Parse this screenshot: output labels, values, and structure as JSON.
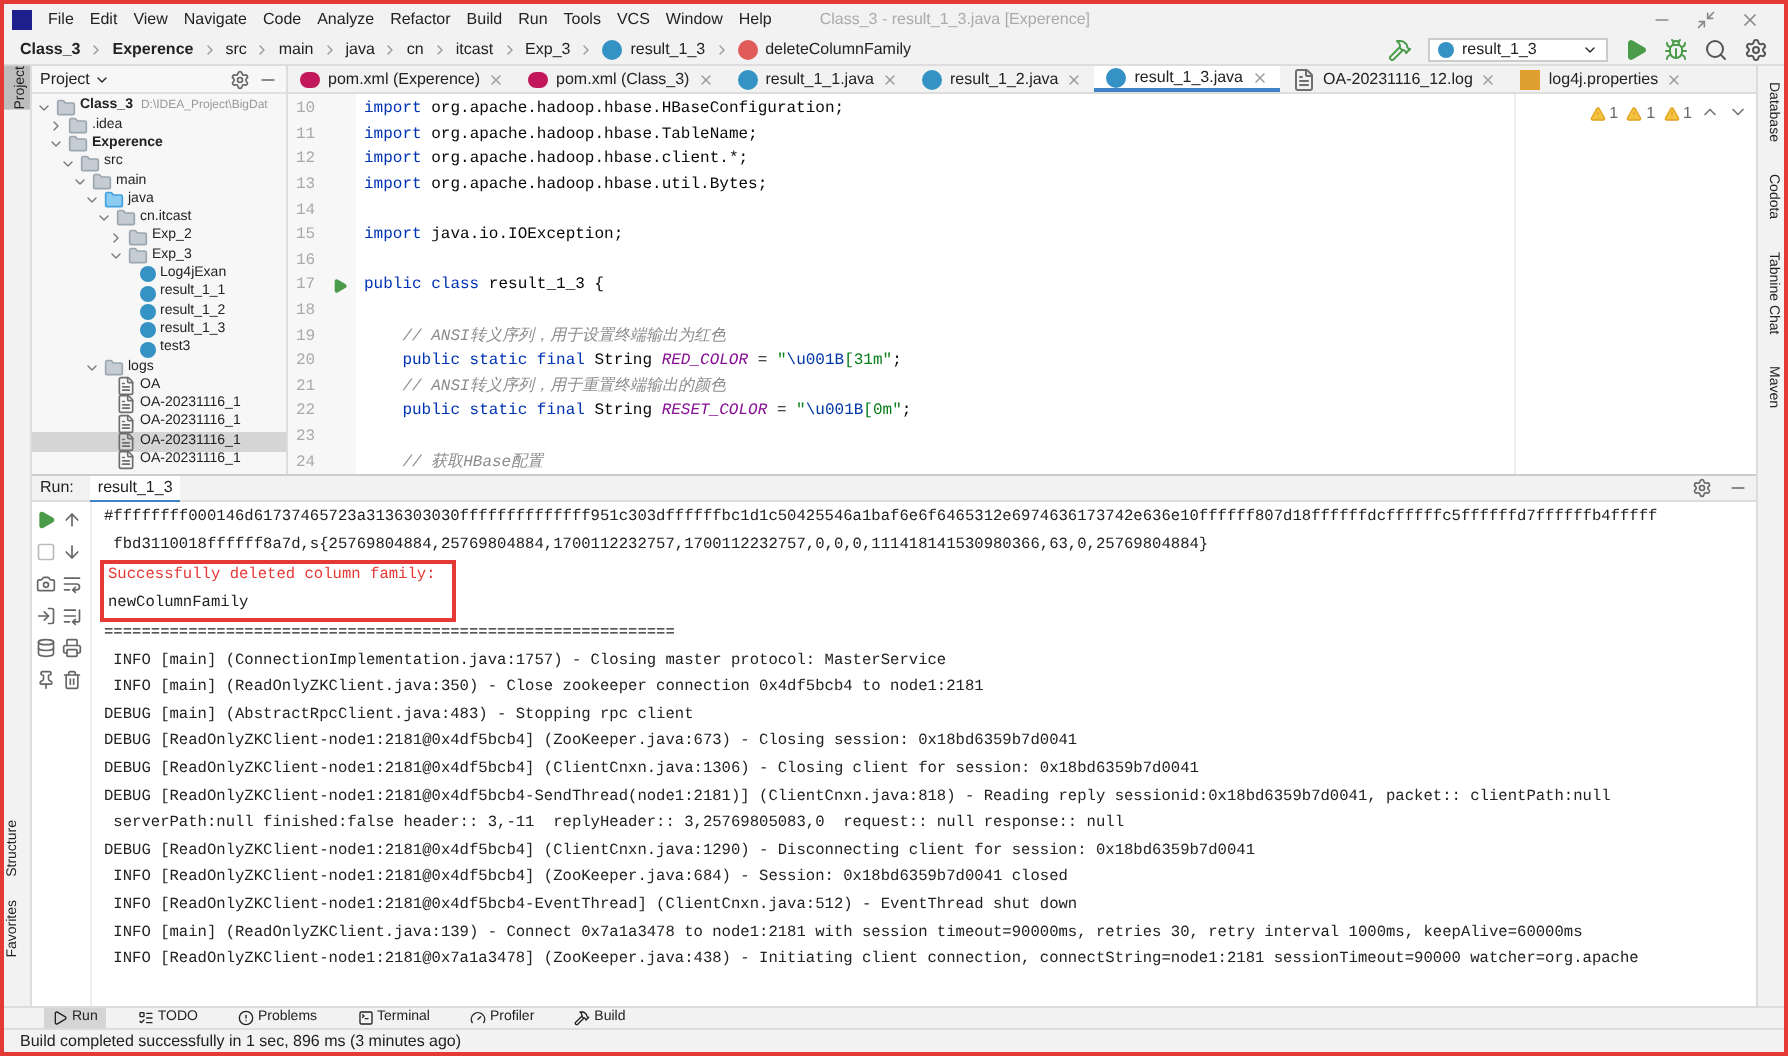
{
  "window": {
    "title": "Class_3 - result_1_3.java [Experence]"
  },
  "menu": [
    "File",
    "Edit",
    "View",
    "Navigate",
    "Code",
    "Analyze",
    "Refactor",
    "Build",
    "Run",
    "Tools",
    "VCS",
    "Window",
    "Help"
  ],
  "breadcrumb": [
    {
      "label": "Class_3",
      "kind": "module"
    },
    {
      "label": "Experence",
      "kind": "module"
    },
    {
      "label": "src",
      "kind": "folder"
    },
    {
      "label": "main",
      "kind": "folder"
    },
    {
      "label": "java",
      "kind": "folder"
    },
    {
      "label": "cn",
      "kind": "folder"
    },
    {
      "label": "itcast",
      "kind": "folder"
    },
    {
      "label": "Exp_3",
      "kind": "folder"
    },
    {
      "label": "result_1_3",
      "kind": "class"
    },
    {
      "label": "deleteColumnFamily",
      "kind": "method"
    }
  ],
  "run_config": "result_1_3",
  "left_stripe": [
    {
      "label": "Project",
      "selected": true
    }
  ],
  "left_stripe_bottom": [
    {
      "label": "Structure"
    },
    {
      "label": "Favorites"
    }
  ],
  "right_stripe": [
    "Database",
    "Codota",
    "Tabnine Chat",
    "Maven"
  ],
  "project": {
    "title": "Project",
    "tree": [
      {
        "label": "Class_3",
        "hint": "D:\\IDEA_Project\\BigDat",
        "kind": "module",
        "expanded": true,
        "selected": false,
        "children": [
          {
            "label": ".idea",
            "kind": "folder",
            "expanded": false,
            "selected": false
          },
          {
            "label": "Experence",
            "kind": "module",
            "expanded": true,
            "selected": false,
            "children": [
              {
                "label": "src",
                "kind": "folder",
                "expanded": true,
                "selected": false,
                "children": [
                  {
                    "label": "main",
                    "kind": "folder",
                    "expanded": true,
                    "selected": false,
                    "children": [
                      {
                        "label": "java",
                        "kind": "source",
                        "expanded": true,
                        "selected": false,
                        "children": [
                          {
                            "label": "cn.itcast",
                            "kind": "folder",
                            "expanded": true,
                            "selected": false,
                            "children": [
                              {
                                "label": "Exp_2",
                                "kind": "folder",
                                "expanded": false,
                                "selected": false
                              },
                              {
                                "label": "Exp_3",
                                "kind": "folder",
                                "expanded": true,
                                "selected": false,
                                "children": [
                                  {
                                    "label": "Log4jExan",
                                    "kind": "class",
                                    "selected": false
                                  },
                                  {
                                    "label": "result_1_1",
                                    "kind": "class",
                                    "selected": false
                                  },
                                  {
                                    "label": "result_1_2",
                                    "kind": "class",
                                    "selected": false
                                  },
                                  {
                                    "label": "result_1_3",
                                    "kind": "class",
                                    "selected": false
                                  },
                                  {
                                    "label": "test3",
                                    "kind": "class",
                                    "selected": false
                                  }
                                ]
                              }
                            ]
                          }
                        ]
                      },
                      {
                        "label": "logs",
                        "kind": "folder",
                        "expanded": true,
                        "selected": false,
                        "children": [
                          {
                            "label": "OA",
                            "kind": "file",
                            "selected": false
                          },
                          {
                            "label": "OA-20231116_1",
                            "kind": "file",
                            "selected": false
                          },
                          {
                            "label": "OA-20231116_1",
                            "kind": "file",
                            "selected": false
                          },
                          {
                            "label": "OA-20231116_1",
                            "kind": "file",
                            "selected": true
                          },
                          {
                            "label": "OA-20231116_1",
                            "kind": "file",
                            "selected": false
                          }
                        ]
                      }
                    ]
                  }
                ]
              }
            ]
          }
        ]
      }
    ]
  },
  "tabs": [
    {
      "label": "pom.xml (Experence)",
      "kind": "maven",
      "selected": false
    },
    {
      "label": "pom.xml (Class_3)",
      "kind": "maven",
      "selected": false
    },
    {
      "label": "result_1_1.java",
      "kind": "class",
      "selected": false
    },
    {
      "label": "result_1_2.java",
      "kind": "class",
      "selected": false
    },
    {
      "label": "result_1_3.java",
      "kind": "class",
      "selected": true
    },
    {
      "label": "OA-20231116_12.log",
      "kind": "log",
      "selected": false
    },
    {
      "label": "log4j.properties",
      "kind": "properties",
      "selected": false
    }
  ],
  "warnings": [
    "1",
    "1",
    "1"
  ],
  "editor": {
    "lines": [
      {
        "number": "10",
        "runnable": false,
        "tokens": [
          {
            "kind": "keyword",
            "text": "import"
          },
          {
            "kind": "plain",
            "text": " org.apache.hadoop.hbase.HBaseConfiguration;"
          }
        ]
      },
      {
        "number": "11",
        "runnable": false,
        "tokens": [
          {
            "kind": "keyword",
            "text": "import"
          },
          {
            "kind": "plain",
            "text": " org.apache.hadoop.hbase.TableName;"
          }
        ]
      },
      {
        "number": "12",
        "runnable": false,
        "tokens": [
          {
            "kind": "keyword",
            "text": "import"
          },
          {
            "kind": "plain",
            "text": " org.apache.hadoop.hbase.client.*;"
          }
        ]
      },
      {
        "number": "13",
        "runnable": false,
        "tokens": [
          {
            "kind": "keyword",
            "text": "import"
          },
          {
            "kind": "plain",
            "text": " org.apache.hadoop.hbase.util.Bytes;"
          }
        ]
      },
      {
        "number": "14",
        "runnable": false
      },
      {
        "number": "15",
        "runnable": false,
        "tokens": [
          {
            "kind": "keyword",
            "text": "import"
          },
          {
            "kind": "plain",
            "text": " java.io.IOException;"
          }
        ]
      },
      {
        "number": "16",
        "runnable": false
      },
      {
        "number": "17",
        "runnable": true,
        "tokens": [
          {
            "kind": "keyword",
            "text": "public class"
          },
          {
            "kind": "plain",
            "text": " result_1_3 {"
          }
        ]
      },
      {
        "number": "18",
        "runnable": false
      },
      {
        "number": "19",
        "runnable": false,
        "tokens": [
          {
            "kind": "comment",
            "text": "    // ANSI转义序列，用于设置终端输出为红色"
          }
        ]
      },
      {
        "number": "20",
        "runnable": false,
        "tokens": [
          {
            "kind": "keyword",
            "text": "    public static final"
          },
          {
            "kind": "plain",
            "text": " String "
          },
          {
            "kind": "field",
            "text": "RED_COLOR"
          },
          {
            "kind": "plain",
            "text": " = "
          },
          {
            "kind": "string",
            "text": "\""
          },
          {
            "kind": "escape",
            "text": "\\u001B"
          },
          {
            "kind": "string",
            "text": "[31m\""
          },
          {
            "kind": "plain",
            "text": ";"
          }
        ]
      },
      {
        "number": "21",
        "runnable": false,
        "tokens": [
          {
            "kind": "comment",
            "text": "    // ANSI转义序列，用于重置终端输出的颜色"
          }
        ]
      },
      {
        "number": "22",
        "runnable": false,
        "tokens": [
          {
            "kind": "keyword",
            "text": "    public static final"
          },
          {
            "kind": "plain",
            "text": " String "
          },
          {
            "kind": "field",
            "text": "RESET_COLOR"
          },
          {
            "kind": "plain",
            "text": " = "
          },
          {
            "kind": "string",
            "text": "\""
          },
          {
            "kind": "escape",
            "text": "\\u001B"
          },
          {
            "kind": "string",
            "text": "[0m\""
          },
          {
            "kind": "plain",
            "text": ";"
          }
        ]
      },
      {
        "number": "23",
        "runnable": false
      },
      {
        "number": "24",
        "runnable": false,
        "tokens": [
          {
            "kind": "comment",
            "text": "    // 获取HBase配置"
          }
        ]
      }
    ]
  },
  "run": {
    "label": "Run:",
    "tab": "result_1_3",
    "lines": [
      {
        "text": "#ffffffff000146d61737465723a3136303030ffffffffffffff951c303dffffffbc1d1c50425546a1baf6e6f6465312e6974636173742e636e10ffffff807d18ffffffdcffffffc5ffffffd7ffffffb4fffff",
        "kind": "normal",
        "highlighted": false
      },
      {
        "text": " fbd3110018ffffff8a7d,s{25769804884,25769804884,1700112232757,1700112232757,0,0,0,111418141530980366,63,0,25769804884}",
        "kind": "normal",
        "highlighted": false
      },
      {
        "text": "Successfully deleted column family:",
        "kind": "error",
        "highlighted": true
      },
      {
        "text": "newColumnFamily",
        "kind": "normal",
        "highlighted": true
      },
      {
        "text": "=============================================================",
        "kind": "normal",
        "highlighted": false
      },
      {
        "text": " INFO [main] (ConnectionImplementation.java:1757) - Closing master protocol: MasterService",
        "kind": "normal",
        "highlighted": false
      },
      {
        "text": " INFO [main] (ReadOnlyZKClient.java:350) - Close zookeeper connection 0x4df5bcb4 to node1:2181",
        "kind": "normal",
        "highlighted": false
      },
      {
        "text": "DEBUG [main] (AbstractRpcClient.java:483) - Stopping rpc client",
        "kind": "normal",
        "highlighted": false
      },
      {
        "text": "DEBUG [ReadOnlyZKClient-node1:2181@0x4df5bcb4] (ZooKeeper.java:673) - Closing session: 0x18bd6359b7d0041",
        "kind": "normal",
        "highlighted": false
      },
      {
        "text": "DEBUG [ReadOnlyZKClient-node1:2181@0x4df5bcb4] (ClientCnxn.java:1306) - Closing client for session: 0x18bd6359b7d0041",
        "kind": "normal",
        "highlighted": false
      },
      {
        "text": "DEBUG [ReadOnlyZKClient-node1:2181@0x4df5bcb4-SendThread(node1:2181)] (ClientCnxn.java:818) - Reading reply sessionid:0x18bd6359b7d0041, packet:: clientPath:null",
        "kind": "normal",
        "highlighted": false
      },
      {
        "text": " serverPath:null finished:false header:: 3,-11  replyHeader:: 3,25769805083,0  request:: null response:: null",
        "kind": "normal",
        "highlighted": false
      },
      {
        "text": "DEBUG [ReadOnlyZKClient-node1:2181@0x4df5bcb4] (ClientCnxn.java:1290) - Disconnecting client for session: 0x18bd6359b7d0041",
        "kind": "normal",
        "highlighted": false
      },
      {
        "text": " INFO [ReadOnlyZKClient-node1:2181@0x4df5bcb4] (ZooKeeper.java:684) - Session: 0x18bd6359b7d0041 closed",
        "kind": "normal",
        "highlighted": false
      },
      {
        "text": " INFO [ReadOnlyZKClient-node1:2181@0x4df5bcb4-EventThread] (ClientCnxn.java:512) - EventThread shut down",
        "kind": "normal",
        "highlighted": false
      },
      {
        "text": " INFO [main] (ReadOnlyZKClient.java:139) - Connect 0x7a1a3478 to node1:2181 with session timeout=90000ms, retries 30, retry interval 1000ms, keepAlive=60000ms",
        "kind": "normal",
        "highlighted": false
      },
      {
        "text": " INFO [ReadOnlyZKClient-node1:2181@0x7a1a3478] (ZooKeeper.java:438) - Initiating client connection, connectString=node1:2181 sessionTimeout=90000 watcher=org.apache",
        "kind": "normal",
        "highlighted": false
      }
    ]
  },
  "bottom_tabs": [
    {
      "label": "Run",
      "selected": true
    },
    {
      "label": "TODO",
      "selected": false
    },
    {
      "label": "Problems",
      "selected": false
    },
    {
      "label": "Terminal",
      "selected": false
    },
    {
      "label": "Profiler",
      "selected": false
    },
    {
      "label": "Build",
      "selected": false
    }
  ],
  "status_bar": "Build completed successfully in 1 sec, 896 ms (3 minutes ago)"
}
